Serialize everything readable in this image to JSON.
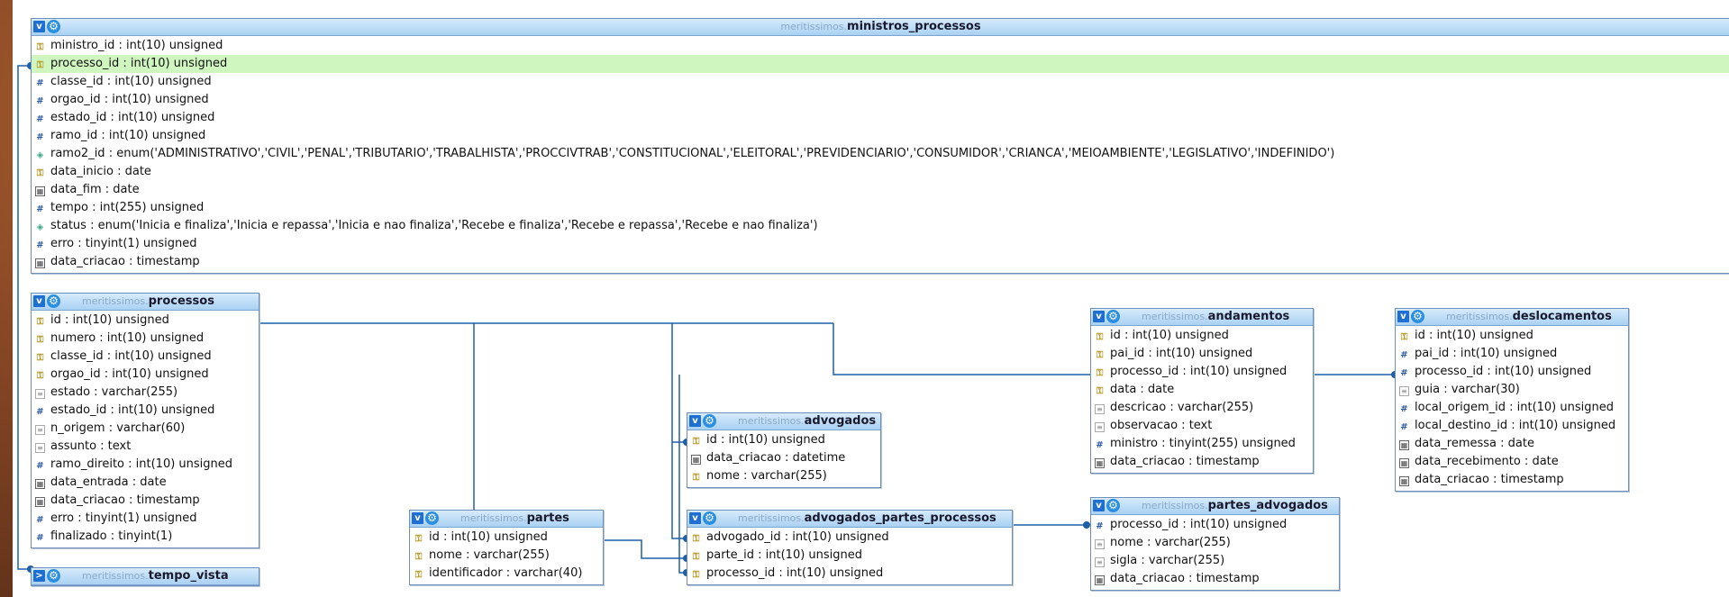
{
  "tables": [
    {
      "key": "ministros_processos",
      "db": "meritissimos.",
      "name": "ministros_processos",
      "toggle": "v",
      "header_align": "center",
      "columns": [
        {
          "icon": "key",
          "text": "ministro_id : int(10) unsigned"
        },
        {
          "icon": "key",
          "text": "processo_id : int(10) unsigned",
          "highlight": true
        },
        {
          "icon": "hash",
          "text": "classe_id : int(10) unsigned"
        },
        {
          "icon": "hash",
          "text": "orgao_id : int(10) unsigned"
        },
        {
          "icon": "hash",
          "text": "estado_id : int(10) unsigned"
        },
        {
          "icon": "hash",
          "text": "ramo_id : int(10) unsigned"
        },
        {
          "icon": "enum",
          "text": "ramo2_id : enum('ADMINISTRATIVO','CIVIL','PENAL','TRIBUTARIO','TRABALHISTA','PROCCIVTRAB','CONSTITUCIONAL','ELEITORAL','PREVIDENCIARIO','CONSUMIDOR','CRIANCA','MEIOAMBIENTE','LEGISLATIVO','INDEFINIDO')"
        },
        {
          "icon": "key",
          "text": "data_inicio : date"
        },
        {
          "icon": "date",
          "text": "data_fim : date"
        },
        {
          "icon": "hash",
          "text": "tempo : int(255) unsigned"
        },
        {
          "icon": "enum",
          "text": "status : enum('Inicia e finaliza','Inicia e repassa','Inicia e nao finaliza','Recebe e finaliza','Recebe e repassa','Recebe e nao finaliza')"
        },
        {
          "icon": "hash",
          "text": "erro : tinyint(1) unsigned"
        },
        {
          "icon": "date",
          "text": "data_criacao : timestamp"
        }
      ]
    },
    {
      "key": "processos",
      "db": "meritissimos.",
      "name": "processos",
      "toggle": "v",
      "columns": [
        {
          "icon": "key",
          "text": "id : int(10) unsigned"
        },
        {
          "icon": "key",
          "text": "numero : int(10) unsigned"
        },
        {
          "icon": "key",
          "text": "classe_id : int(10) unsigned"
        },
        {
          "icon": "key",
          "text": "orgao_id : int(10) unsigned"
        },
        {
          "icon": "text",
          "text": "estado : varchar(255)"
        },
        {
          "icon": "hash",
          "text": "estado_id : int(10) unsigned"
        },
        {
          "icon": "text",
          "text": "n_origem : varchar(60)"
        },
        {
          "icon": "text",
          "text": "assunto : text"
        },
        {
          "icon": "hash",
          "text": "ramo_direito : int(10) unsigned"
        },
        {
          "icon": "date",
          "text": "data_entrada : date"
        },
        {
          "icon": "date",
          "text": "data_criacao : timestamp"
        },
        {
          "icon": "hash",
          "text": "erro : tinyint(1) unsigned"
        },
        {
          "icon": "hash",
          "text": "finalizado : tinyint(1)"
        }
      ]
    },
    {
      "key": "tempo_vista",
      "db": "meritissimos.",
      "name": "tempo_vista",
      "toggle": ">",
      "columns": []
    },
    {
      "key": "partes",
      "db": "meritissimos.",
      "name": "partes",
      "toggle": "v",
      "columns": [
        {
          "icon": "key",
          "text": "id : int(10) unsigned"
        },
        {
          "icon": "key",
          "text": "nome : varchar(255)"
        },
        {
          "icon": "key",
          "text": "identificador : varchar(40)"
        }
      ]
    },
    {
      "key": "advogados",
      "db": "meritissimos.",
      "name": "advogados",
      "toggle": "v",
      "columns": [
        {
          "icon": "key",
          "text": "id : int(10) unsigned"
        },
        {
          "icon": "date",
          "text": "data_criacao : datetime"
        },
        {
          "icon": "key",
          "text": "nome : varchar(255)"
        }
      ]
    },
    {
      "key": "advogados_partes_processos",
      "db": "meritissimos.",
      "name": "advogados_partes_processos",
      "toggle": "v",
      "columns": [
        {
          "icon": "key",
          "text": "advogado_id : int(10) unsigned"
        },
        {
          "icon": "key",
          "text": "parte_id : int(10) unsigned"
        },
        {
          "icon": "key",
          "text": "processo_id : int(10) unsigned"
        }
      ]
    },
    {
      "key": "andamentos",
      "db": "meritissimos.",
      "name": "andamentos",
      "toggle": "v",
      "columns": [
        {
          "icon": "key",
          "text": "id : int(10) unsigned"
        },
        {
          "icon": "key",
          "text": "pai_id : int(10) unsigned"
        },
        {
          "icon": "key",
          "text": "processo_id : int(10) unsigned"
        },
        {
          "icon": "key",
          "text": "data : date"
        },
        {
          "icon": "text",
          "text": "descricao : varchar(255)"
        },
        {
          "icon": "text",
          "text": "observacao : text"
        },
        {
          "icon": "hash",
          "text": "ministro : tinyint(255) unsigned"
        },
        {
          "icon": "date",
          "text": "data_criacao : timestamp"
        }
      ]
    },
    {
      "key": "partes_advogados",
      "db": "meritissimos.",
      "name": "partes_advogados",
      "toggle": "v",
      "columns": [
        {
          "icon": "hash",
          "text": "processo_id : int(10) unsigned"
        },
        {
          "icon": "text",
          "text": "nome : varchar(255)"
        },
        {
          "icon": "text",
          "text": "sigla : varchar(255)"
        },
        {
          "icon": "date",
          "text": "data_criacao : timestamp"
        }
      ]
    },
    {
      "key": "deslocamentos",
      "db": "meritissimos.",
      "name": "deslocamentos",
      "toggle": "v",
      "columns": [
        {
          "icon": "key",
          "text": "id : int(10) unsigned"
        },
        {
          "icon": "hash",
          "text": "pai_id : int(10) unsigned"
        },
        {
          "icon": "hash",
          "text": "processo_id : int(10) unsigned"
        },
        {
          "icon": "text",
          "text": "guia : varchar(30)"
        },
        {
          "icon": "hash",
          "text": "local_origem_id : int(10) unsigned"
        },
        {
          "icon": "hash",
          "text": "local_destino_id : int(10) unsigned"
        },
        {
          "icon": "date",
          "text": "data_remessa : date"
        },
        {
          "icon": "date",
          "text": "data_recebimento : date"
        },
        {
          "icon": "date",
          "text": "data_criacao : timestamp"
        }
      ]
    }
  ],
  "icon_glyphs": {
    "key": "⚿",
    "hash": "#",
    "enum": "◈",
    "text": "≡",
    "date": "▦"
  },
  "colors": {
    "line": "#1f5fa8",
    "highlight": "#d0f6c0",
    "header": "#a9d1f3"
  }
}
